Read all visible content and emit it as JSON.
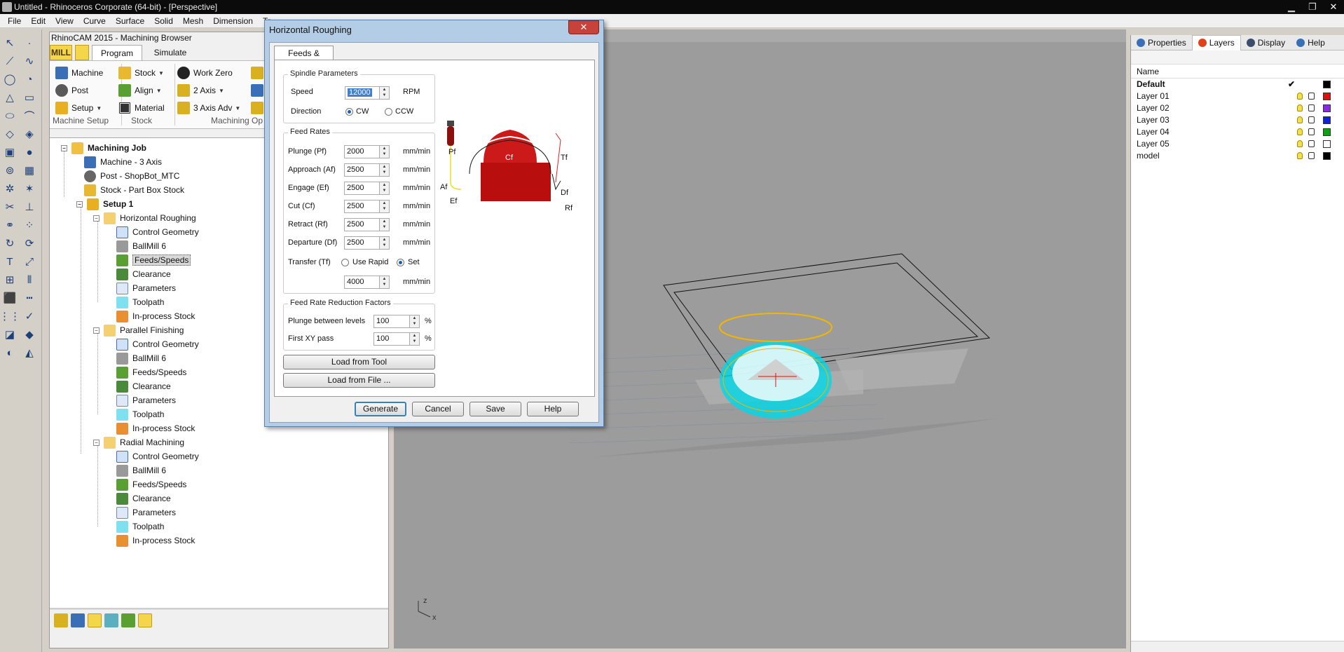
{
  "window": {
    "title": "Untitled - Rhinoceros Corporate (64-bit) - [Perspective]"
  },
  "menu": [
    "File",
    "Edit",
    "View",
    "Curve",
    "Surface",
    "Solid",
    "Mesh",
    "Dimension",
    "Tr"
  ],
  "browser": {
    "title": "RhinoCAM 2015 - Machining Browser",
    "mill_label": "MILL",
    "tabs": {
      "program": "Program",
      "simulate": "Simulate"
    },
    "ribbon": {
      "machine": "Machine",
      "post": "Post",
      "setup": "Setup",
      "stock": "Stock",
      "align": "Align",
      "material": "Material",
      "work_zero": "Work Zero",
      "two_axis": "2 Axis",
      "three_axis_adv": "3 Axis Adv",
      "group_machine_setup": "Machine Setup",
      "group_stock": "Stock",
      "group_machining_ops": "Machining Op"
    },
    "tree": {
      "job": "Machining Job",
      "machine": "Machine - 3 Axis",
      "post": "Post - ShopBot_MTC",
      "stock": "Stock - Part Box Stock",
      "setup": "Setup 1",
      "ops": [
        {
          "name": "Horizontal Roughing",
          "children": [
            "Control Geometry",
            "BallMill 6",
            "Feeds/Speeds",
            "Clearance",
            "Parameters",
            "Toolpath",
            "In-process Stock"
          ]
        },
        {
          "name": "Parallel Finishing",
          "children": [
            "Control Geometry",
            "BallMill 6",
            "Feeds/Speeds",
            "Clearance",
            "Parameters",
            "Toolpath",
            "In-process Stock"
          ]
        },
        {
          "name": "Radial Machining",
          "children": [
            "Control Geometry",
            "BallMill 6",
            "Feeds/Speeds",
            "Clearance",
            "Parameters",
            "Toolpath",
            "In-process Stock"
          ]
        }
      ]
    }
  },
  "layers_panel": {
    "tabs": {
      "properties": "Properties",
      "layers": "Layers",
      "display": "Display",
      "help": "Help"
    },
    "column_name": "Name",
    "rows": [
      {
        "name": "Default",
        "color": "#000000",
        "current": true
      },
      {
        "name": "Layer 01",
        "color": "#e01010"
      },
      {
        "name": "Layer 02",
        "color": "#8a2be2"
      },
      {
        "name": "Layer 03",
        "color": "#1020e0"
      },
      {
        "name": "Layer 04",
        "color": "#10a010"
      },
      {
        "name": "Layer 05",
        "color": "#ffffff"
      },
      {
        "name": "model",
        "color": "#000000"
      }
    ],
    "check_mark": "✔"
  },
  "dialog": {
    "title": "Horizontal Roughing",
    "close": "✕",
    "tab": "Feeds & Speeds",
    "spindle": {
      "title": "Spindle Parameters",
      "speed_label": "Speed",
      "speed_value": "12000",
      "speed_unit": "RPM",
      "direction_label": "Direction",
      "cw": "CW",
      "ccw": "CCW"
    },
    "feeds": {
      "title": "Feed Rates",
      "unit": "mm/min",
      "rows": [
        {
          "label": "Plunge (Pf)",
          "value": "2000"
        },
        {
          "label": "Approach (Af)",
          "value": "2500"
        },
        {
          "label": "Engage (Ef)",
          "value": "2500"
        },
        {
          "label": "Cut (Cf)",
          "value": "2500"
        },
        {
          "label": "Retract (Rf)",
          "value": "2500"
        },
        {
          "label": "Departure  (Df)",
          "value": "2500"
        }
      ],
      "transfer_label": "Transfer (Tf)",
      "use_rapid": "Use Rapid",
      "set": "Set",
      "transfer_value": "4000"
    },
    "reduction": {
      "title": "Feed Rate Reduction Factors",
      "plunge_label": "Plunge between levels",
      "plunge_value": "100",
      "first_label": "First XY pass",
      "first_value": "100",
      "pct": "%"
    },
    "load_tool": "Load from Tool",
    "load_file": "Load from File ...",
    "buttons": {
      "generate": "Generate",
      "cancel": "Cancel",
      "save": "Save",
      "help": "Help"
    },
    "diagram_labels": {
      "pf": "Pf",
      "cf": "Cf",
      "tf": "Tf",
      "af": "Af",
      "df": "Df",
      "ef": "Ef",
      "rf": "Rf"
    }
  },
  "viewport": {
    "axis_x": "x",
    "axis_z": "z"
  }
}
